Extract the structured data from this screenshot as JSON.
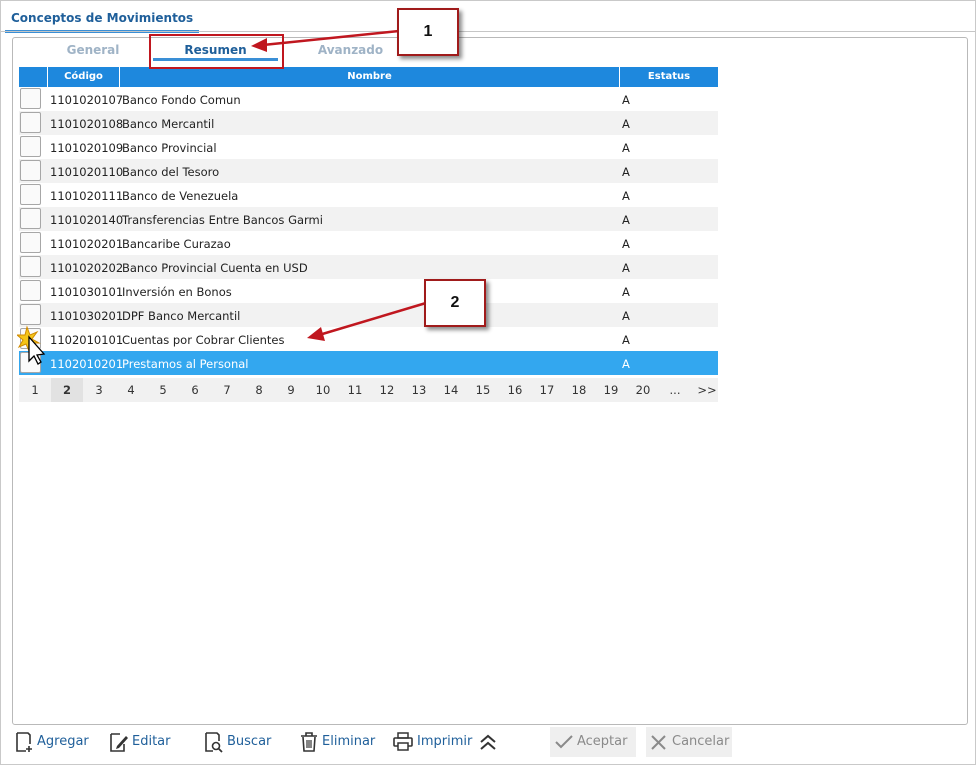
{
  "window": {
    "title_tab": "Conceptos de Movimientos"
  },
  "subtabs": [
    {
      "label": "General"
    },
    {
      "label": "Resumen"
    },
    {
      "label": "Avanzado"
    }
  ],
  "grid": {
    "columns": {
      "code": "Código",
      "name": "Nombre",
      "status": "Estatus"
    },
    "rows": [
      {
        "code": "1101020107",
        "name": "Banco Fondo Comun",
        "status": "A"
      },
      {
        "code": "1101020108",
        "name": "Banco Mercantil",
        "status": "A"
      },
      {
        "code": "1101020109",
        "name": "Banco Provincial",
        "status": "A"
      },
      {
        "code": "1101020110",
        "name": "Banco del Tesoro",
        "status": "A"
      },
      {
        "code": "1101020111",
        "name": "Banco de Venezuela",
        "status": "A"
      },
      {
        "code": "1101020140",
        "name": "Transferencias Entre Bancos Garmi",
        "status": "A"
      },
      {
        "code": "1101020201",
        "name": "Bancaribe Curazao",
        "status": "A"
      },
      {
        "code": "1101020202",
        "name": "Banco Provincial Cuenta en USD",
        "status": "A"
      },
      {
        "code": "1101030101",
        "name": "Inversión en Bonos",
        "status": "A"
      },
      {
        "code": "1101030201",
        "name": "DPF Banco Mercantil",
        "status": "A"
      },
      {
        "code": "1102010101",
        "name": "Cuentas por Cobrar Clientes",
        "status": "A"
      },
      {
        "code": "1102010201",
        "name": "Prestamos al Personal",
        "status": "A"
      }
    ],
    "selected_row": 11
  },
  "pager": {
    "pages": [
      "1",
      "2",
      "3",
      "4",
      "5",
      "6",
      "7",
      "8",
      "9",
      "10",
      "11",
      "12",
      "13",
      "14",
      "15",
      "16",
      "17",
      "18",
      "19",
      "20",
      "...",
      ">>"
    ],
    "current": "2"
  },
  "callouts": {
    "one": "1",
    "two": "2"
  },
  "toolbar": {
    "add": "Agregar",
    "edit": "Editar",
    "search": "Buscar",
    "delete": "Eliminar",
    "print": "Imprimir",
    "accept": "Aceptar",
    "cancel": "Cancelar"
  },
  "colors": {
    "header_blue": "#1e88dd",
    "selected_row": "#33a7ef",
    "callout_red": "#c0171f"
  }
}
